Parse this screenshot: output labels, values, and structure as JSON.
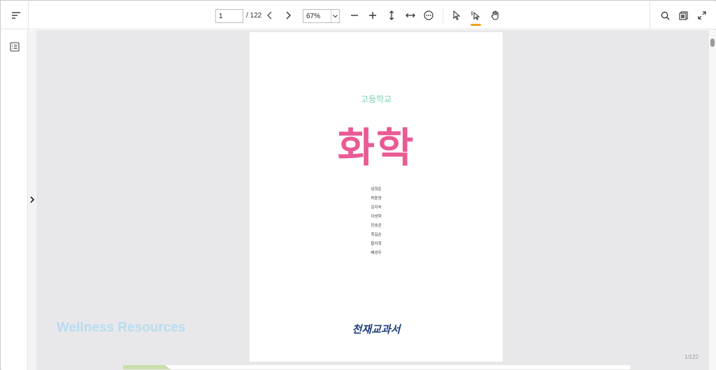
{
  "toolbar": {
    "page_number": "1",
    "page_total": "/ 122",
    "zoom": "67%",
    "icons": [
      "menu-icon",
      "chevron-left-icon",
      "chevron-right-icon",
      "zoom-out-icon",
      "zoom-in-icon",
      "fit-height-icon",
      "fit-width-icon",
      "more-icon",
      "pointer-icon",
      "text-select-icon",
      "hand-icon",
      "search-icon",
      "thumbnails-icon",
      "fullscreen-icon"
    ],
    "accent_color": "#f5a11b"
  },
  "sidebar": {
    "icons": [
      "toc-icon",
      "expand-arrow-icon"
    ]
  },
  "document": {
    "subtitle": "고등학교",
    "title": "화학",
    "authors": [
      "임희준",
      "허윤경",
      "김지숙",
      "이성학",
      "진호균",
      "최길순",
      "황지혁",
      "배성우"
    ],
    "publisher": "천재교과서",
    "title_color": "#ea5a94",
    "subtitle_color": "#7fd0b2"
  },
  "overlay": {
    "watermark": "Wellness Resources",
    "page_indicator": "1/122"
  }
}
